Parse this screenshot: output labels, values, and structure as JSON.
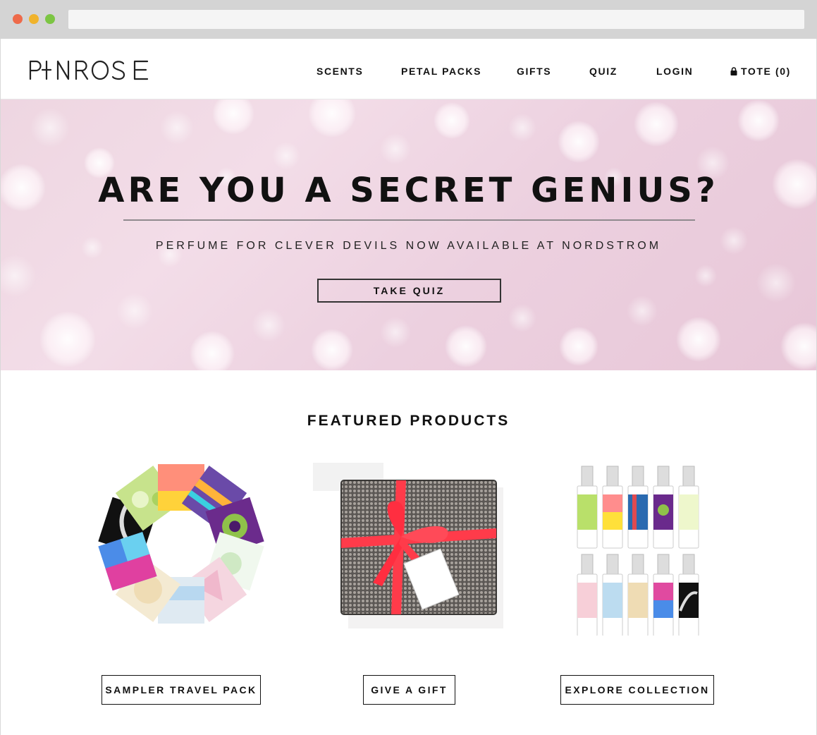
{
  "brand": {
    "logo_text": "PINROSE"
  },
  "nav": {
    "scents": "SCENTS",
    "petal_packs": "PETAL PACKS",
    "gifts": "GIFTS",
    "quiz": "QUIZ",
    "login": "LOGIN",
    "tote": "TOTE (0)",
    "tote_icon": "lock-icon"
  },
  "hero": {
    "title": "ARE YOU A SECRET GENIUS?",
    "subtitle": "PERFUME FOR CLEVER DEVILS NOW AVAILABLE AT NORDSTROM",
    "cta": "TAKE QUIZ"
  },
  "featured": {
    "title": "FEATURED PRODUCTS",
    "products": [
      {
        "button": "SAMPLER TRAVEL PACK"
      },
      {
        "button": "GIVE A GIFT"
      },
      {
        "button": "EXPLORE COLLECTION"
      }
    ]
  },
  "colors": {
    "hero_pink": "#eed6e1",
    "ribbon_red": "#ff3b4a",
    "text": "#111111"
  }
}
